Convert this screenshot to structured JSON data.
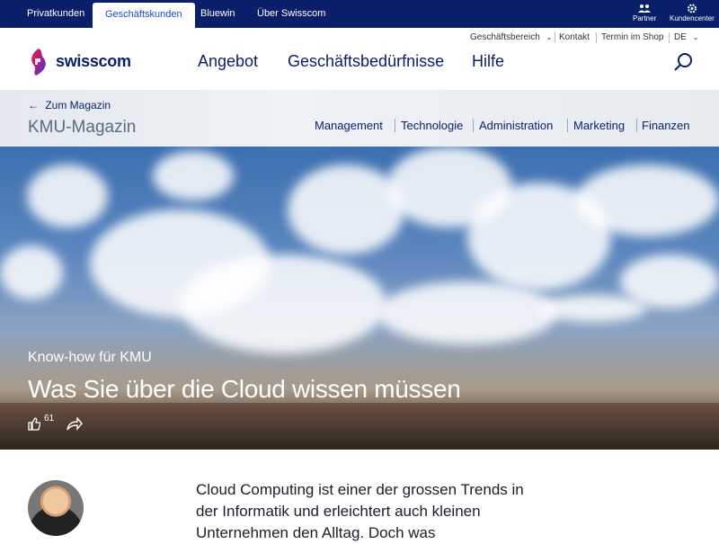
{
  "topbar": {
    "segments": [
      "Privatkunden",
      "Geschäftskunden",
      "Bluewin",
      "Über Swisscom"
    ],
    "partner_label": "Partner",
    "kundencenter_label": "Kundencenter"
  },
  "utility": {
    "business_area": "Geschäftsbereich",
    "contact": "Kontakt",
    "shop": "Termin im Shop",
    "language": "DE"
  },
  "brand": {
    "name": "swisscom"
  },
  "mainnav": [
    "Angebot",
    "Geschäftsbedürfnisse",
    "Hilfe"
  ],
  "magazine": {
    "back_label": "Zum Magazin",
    "title": "KMU-Magazin",
    "categories": [
      "Management",
      "Technologie",
      "Administration",
      "Marketing",
      "Finanzen"
    ]
  },
  "hero": {
    "eyebrow": "Know-how für KMU",
    "title": "Was Sie über die Cloud wissen müssen",
    "likes": "61"
  },
  "article": {
    "intro": "Cloud Computing ist einer der grossen Trends in der Informatik und erleichtert auch kleinen Unternehmen den Alltag. Doch was"
  },
  "colors": {
    "navy": "#0a1f6a",
    "link_blue": "#1b4bd0"
  }
}
